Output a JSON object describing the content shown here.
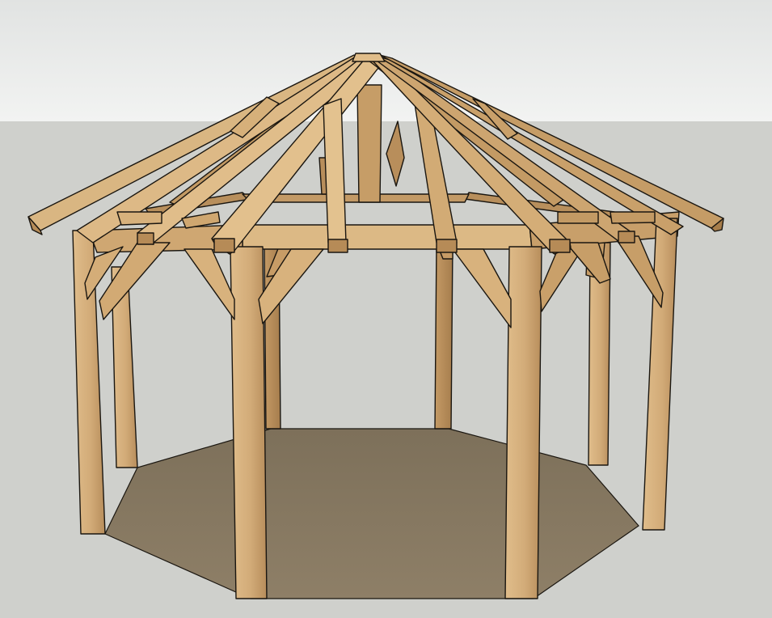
{
  "viewport": {
    "label": "",
    "colors": {
      "sky_top": "#e1e3e2",
      "sky_bottom": "#f2f3f2",
      "ground": "#cfd0cc",
      "floor": "#8a7b64",
      "floor_shadow": "#7c6f59",
      "wood_light": "#ddb986",
      "wood_mid": "#c9a06a",
      "wood_dark": "#a98152",
      "edge": "#1a1610"
    }
  },
  "model": {
    "subject": "octagonal-timber-gazebo",
    "post_count": 8,
    "rafter_style": "hip-roof-radial"
  }
}
